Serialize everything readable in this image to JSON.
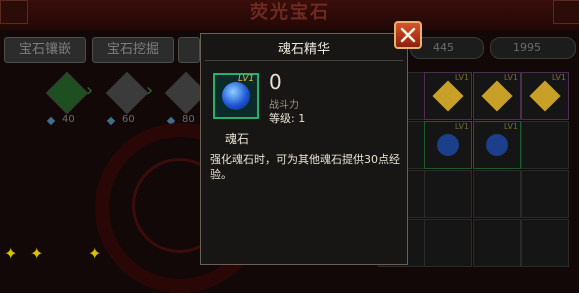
{
  "header": {
    "title": "荧光宝石"
  },
  "tabs": [
    {
      "label": "宝石镶嵌"
    },
    {
      "label": "宝石挖掘"
    }
  ],
  "currencies": [
    {
      "value": "445"
    },
    {
      "value": "1995"
    }
  ],
  "upgrade_costs": [
    "40",
    "60",
    "80"
  ],
  "grid": {
    "level_badge": "LV1"
  },
  "tooltip": {
    "title": "魂石精华",
    "level_badge": "LV1",
    "power_value": "0",
    "power_label": "战斗力",
    "level_text": "等级: 1",
    "item_name": "魂石",
    "description": "强化魂石时，可为其他魂石提供30点经验。"
  },
  "colors": {
    "accent_green": "#27b06a",
    "close_red": "#c8401f",
    "text_light": "#e9e2d4"
  }
}
